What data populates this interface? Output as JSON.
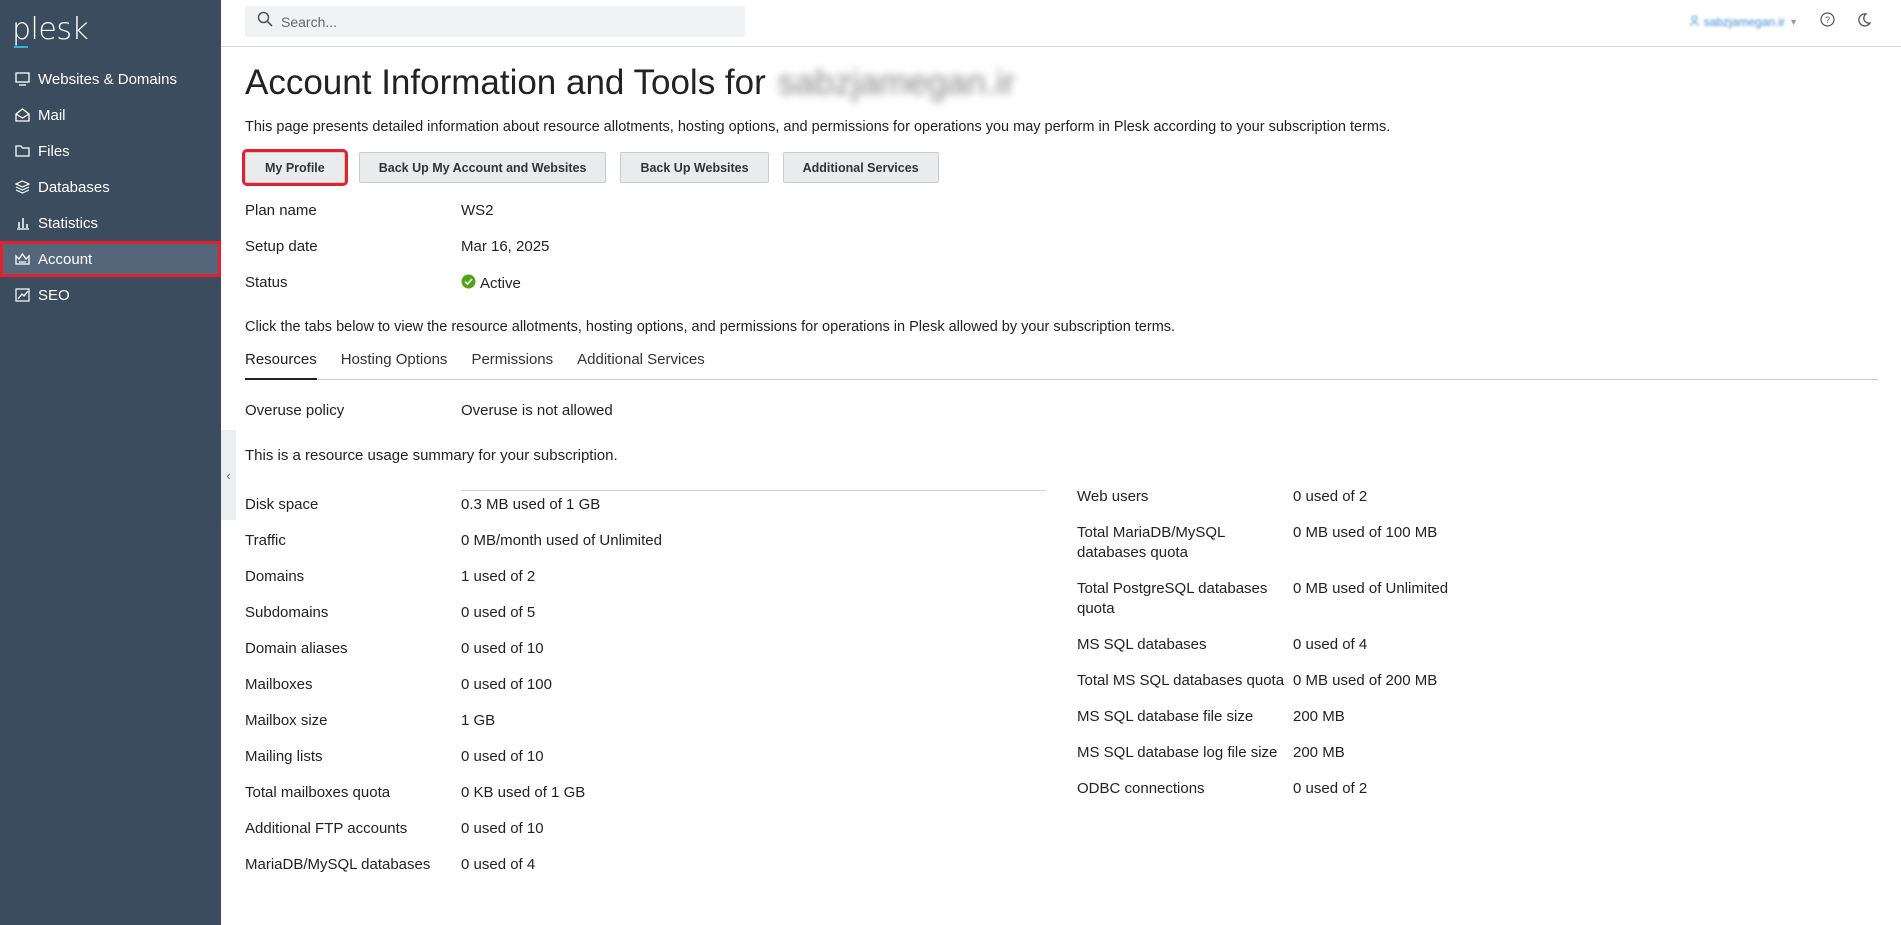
{
  "brand": {
    "name": "plesk"
  },
  "sidebar": {
    "items": [
      {
        "label": "Websites & Domains",
        "icon": "monitor-icon"
      },
      {
        "label": "Mail",
        "icon": "mail-icon"
      },
      {
        "label": "Files",
        "icon": "folder-icon"
      },
      {
        "label": "Databases",
        "icon": "database-icon"
      },
      {
        "label": "Statistics",
        "icon": "bar-chart-icon"
      },
      {
        "label": "Account",
        "icon": "account-icon",
        "active": true
      },
      {
        "label": "SEO",
        "icon": "seo-icon"
      }
    ]
  },
  "topbar": {
    "search_placeholder": "Search...",
    "user_name": "sabzjamegan.ir"
  },
  "page": {
    "title": "Account Information and Tools for",
    "title_domain": "sabzjamegan.ir",
    "description": "This page presents detailed information about resource allotments, hosting options, and permissions for operations you may perform in Plesk according to your subscription terms.",
    "buttons": [
      "My Profile",
      "Back Up My Account and Websites",
      "Back Up Websites",
      "Additional Services"
    ],
    "plan_label": "Plan name",
    "plan_value": "WS2",
    "setup_label": "Setup date",
    "setup_value": "Mar 16, 2025",
    "status_label": "Status",
    "status_value": "Active",
    "tabs_hint": "Click the tabs below to view the resource allotments, hosting options, and permissions for operations in Plesk allowed by your subscription terms.",
    "tabs": [
      "Resources",
      "Hosting Options",
      "Permissions",
      "Additional Services"
    ],
    "overuse_label": "Overuse policy",
    "overuse_value": "Overuse is not allowed",
    "summary_text": "This is a resource usage summary for your subscription."
  },
  "usage_left": [
    {
      "k": "Disk space",
      "v": "0.3 MB used of 1 GB"
    },
    {
      "k": "Traffic",
      "v": "0 MB/month used of Unlimited"
    },
    {
      "k": "Domains",
      "v": "1 used of 2"
    },
    {
      "k": "Subdomains",
      "v": "0 used of 5"
    },
    {
      "k": "Domain aliases",
      "v": "0 used of 10"
    },
    {
      "k": "Mailboxes",
      "v": "0 used of 100"
    },
    {
      "k": "Mailbox size",
      "v": "1 GB"
    },
    {
      "k": "Mailing lists",
      "v": "0 used of 10"
    },
    {
      "k": "Total mailboxes quota",
      "v": "0 KB used of 1 GB"
    },
    {
      "k": "Additional FTP accounts",
      "v": "0 used of 10"
    },
    {
      "k": "MariaDB/MySQL databases",
      "v": "0 used of 4"
    }
  ],
  "usage_right": [
    {
      "k": "Web users",
      "v": "0 used of 2"
    },
    {
      "k": "Total MariaDB/MySQL databases quota",
      "v": "0 MB used of 100 MB"
    },
    {
      "k": "Total PostgreSQL databases quota",
      "v": "0 MB used of Unlimited"
    },
    {
      "k": "MS SQL databases",
      "v": "0 used of 4"
    },
    {
      "k": "Total MS SQL databases quota",
      "v": "0 MB used of 200 MB"
    },
    {
      "k": "MS SQL database file size",
      "v": "200 MB"
    },
    {
      "k": "MS SQL database log file size",
      "v": "200 MB"
    },
    {
      "k": "ODBC connections",
      "v": "0 used of 2"
    }
  ],
  "colors": {
    "sidebar": "#3b4c5e",
    "highlight": "#e3202e",
    "status_ok": "#53a318"
  }
}
